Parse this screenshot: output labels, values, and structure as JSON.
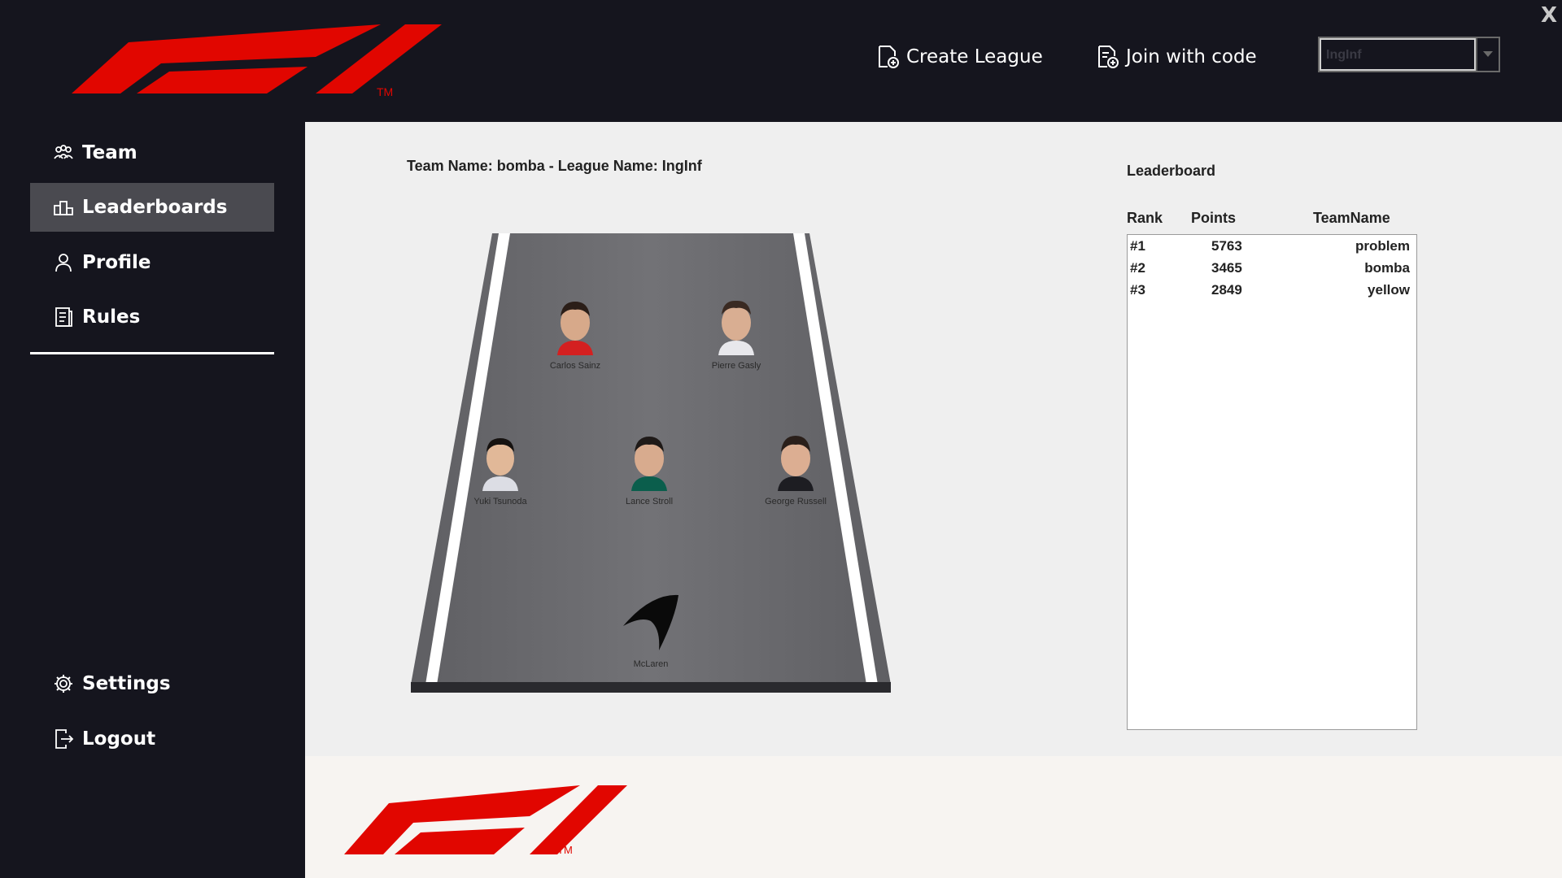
{
  "window": {
    "close_label": "X"
  },
  "header": {
    "logo_tm": "TM",
    "create_league_label": "Create League",
    "join_code_label": "Join with code",
    "league_select_value": "IngInf"
  },
  "sidebar": {
    "items": [
      {
        "label": "Team",
        "icon": "team-icon"
      },
      {
        "label": "Leaderboards",
        "icon": "leaderboard-icon",
        "active": true
      },
      {
        "label": "Profile",
        "icon": "profile-icon"
      },
      {
        "label": "Rules",
        "icon": "rules-icon"
      },
      {
        "label": "Settings",
        "icon": "gear-icon"
      },
      {
        "label": "Logout",
        "icon": "logout-icon"
      }
    ]
  },
  "main": {
    "team_info": "Team Name: bomba - League Name: IngInf",
    "drivers": [
      {
        "name": "Carlos Sainz"
      },
      {
        "name": "Pierre Gasly"
      },
      {
        "name": "Yuki Tsunoda"
      },
      {
        "name": "Lance Stroll"
      },
      {
        "name": "George Russell"
      }
    ],
    "constructor": {
      "name": "McLaren"
    }
  },
  "leaderboard": {
    "title": "Leaderboard",
    "columns": [
      "Rank",
      "Points",
      "TeamName"
    ],
    "rows": [
      {
        "rank": "#1",
        "points": "5763",
        "team": "problem"
      },
      {
        "rank": "#2",
        "points": "3465",
        "team": "bomba"
      },
      {
        "rank": "#3",
        "points": "2849",
        "team": "yellow"
      }
    ]
  },
  "footer": {
    "logo_tm": "TM"
  },
  "colors": {
    "brand_red": "#e10600",
    "sidebar_bg": "#15151e",
    "active_item": "#4a4a50",
    "content_bg": "#efefef"
  }
}
